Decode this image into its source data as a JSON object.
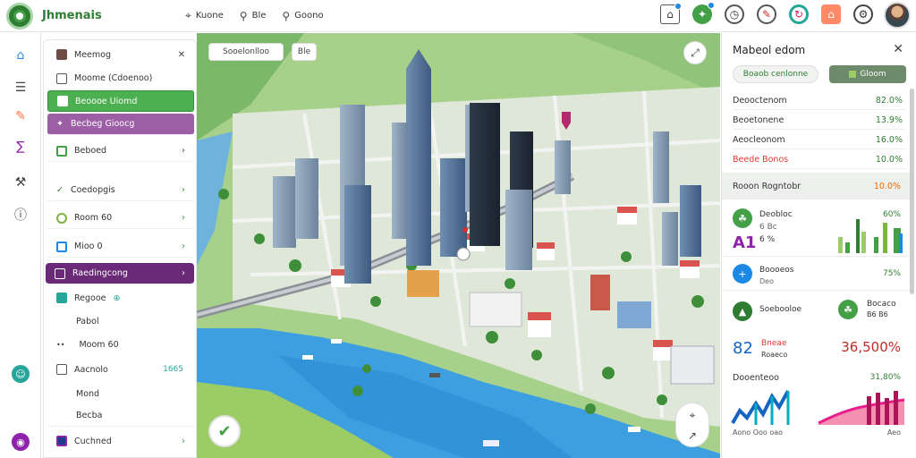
{
  "app": {
    "title": "Jhmenais"
  },
  "topnav": [
    {
      "label": "Kuone",
      "icon": "pin-icon"
    },
    {
      "label": "Ble",
      "icon": "search-icon"
    },
    {
      "label": "Goono",
      "icon": "search-icon"
    }
  ],
  "sidepanel": {
    "header": "Meemog",
    "rows": [
      {
        "label": "Moome (Cdoenoo)"
      },
      {
        "label": "Beoooe Uiomd"
      },
      {
        "label": "Becbeg Gioocg"
      },
      {
        "label": "Beboed"
      },
      {
        "label": "Coedopgis"
      },
      {
        "label": "Room 60"
      },
      {
        "label": "Mioo 0"
      },
      {
        "label": "Raedingcong"
      },
      {
        "label": "Regooe"
      },
      {
        "label": "Pabol"
      },
      {
        "label": "Moom 60"
      },
      {
        "label": "Aacnolo",
        "value": "1665"
      },
      {
        "label": "Mond"
      },
      {
        "label": "Becba"
      },
      {
        "label": "Cuchned"
      }
    ]
  },
  "map": {
    "labels": {
      "search": "Sooelonlloo",
      "other": "Ble"
    }
  },
  "rpanel": {
    "title": "Mabeol edom",
    "tabs": {
      "left": "Boaob cenlonne",
      "right": "Gloom"
    },
    "stats": [
      {
        "label": "Deooctenom",
        "value": "82.0%"
      },
      {
        "label": "Beoetonene",
        "value": "13.9%"
      },
      {
        "label": "Aeocleonom",
        "value": "16.0%"
      },
      {
        "label": "Beede Bonos",
        "value": "10.0%"
      }
    ],
    "band": {
      "label": "Rooon Rogntobr",
      "value": "10.0%"
    },
    "card1": {
      "name": "Deobloc",
      "sub": "6 Bc",
      "big": "A1",
      "pct1": "6 %",
      "pct2": "60%"
    },
    "card2": {
      "name": "Boooeos",
      "sub": "Deo",
      "value": "75%"
    },
    "card3": {
      "name": "Soebooloe",
      "sub": "Bocaco",
      "sub2": "B6 B6"
    },
    "card4": {
      "big": "82",
      "label": "Bneae",
      "sub": "Roaeco",
      "value": "36,500%"
    },
    "card5": {
      "name": "Dooenteoo",
      "value": "31,80%",
      "footer": "Aono  Ooo  oao",
      "footer2": "Aeo"
    }
  },
  "colors": {
    "accent": "#4caf50",
    "purple": "#6a2a78",
    "teal": "#26a69a",
    "pink": "#e91e8c",
    "red": "#e53935"
  }
}
